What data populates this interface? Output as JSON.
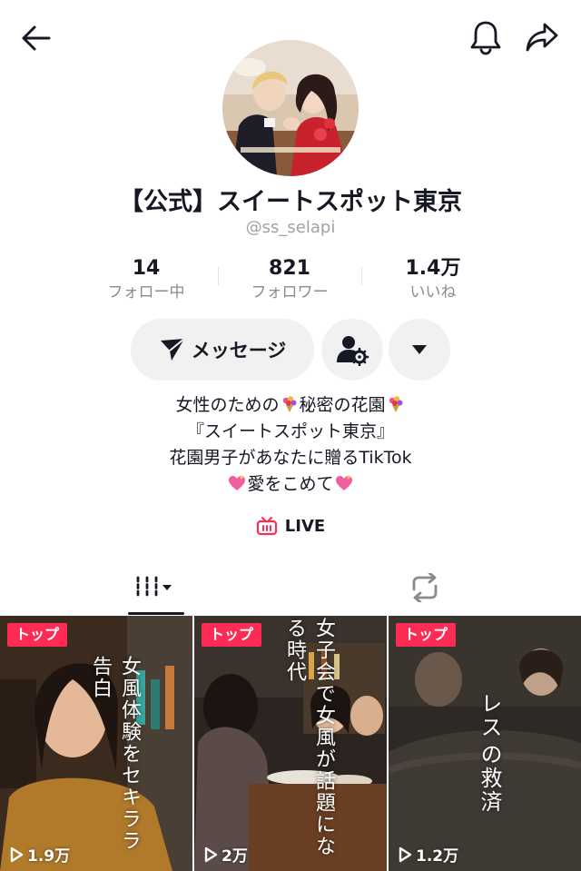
{
  "profile": {
    "name": "【公式】スイートスポット東京",
    "handle": "@ss_selapi"
  },
  "stats": [
    {
      "value": "14",
      "label": "フォロー中"
    },
    {
      "value": "821",
      "label": "フォロワー"
    },
    {
      "value": "1.4万",
      "label": "いいね"
    }
  ],
  "actions": {
    "message_label": "メッセージ"
  },
  "bio": {
    "line1_a": "女性のための",
    "line1_b": "秘密の花園",
    "line2": "『スイートスポット東京』",
    "line3": "花園男子があなたに贈るTikTok",
    "line4": "愛をこめて"
  },
  "live_label": "LIVE",
  "videos": [
    {
      "badge": "トップ",
      "views": "1.9万",
      "caption": "女風体験をセキララ告白"
    },
    {
      "badge": "トップ",
      "views": "2万",
      "caption": "女子会で女風が話題になる時代"
    },
    {
      "badge": "トップ",
      "views": "1.2万",
      "caption_1": "レス",
      "caption_2": "の救済"
    }
  ],
  "colors": {
    "accent": "#fe2c55",
    "text": "#161823",
    "muted": "#8a8b91",
    "button_bg": "#f1f1f2"
  },
  "icons": [
    "back-arrow-icon",
    "bell-icon",
    "share-icon",
    "send-icon",
    "user-settings-icon",
    "caret-down-icon",
    "bouquet-icon",
    "sparkling-heart-icon",
    "live-tv-icon",
    "grid-icon",
    "repost-icon",
    "play-icon"
  ]
}
